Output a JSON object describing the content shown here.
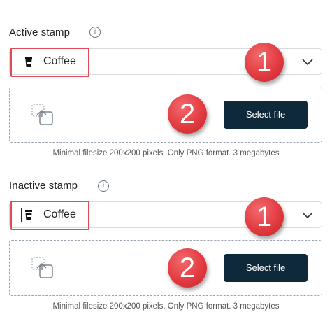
{
  "active_stamp": {
    "title": "Active stamp",
    "info_icon": "i",
    "select_value": "Coffee",
    "select_icon": "coffee-cup-icon",
    "select_file_label": "Select file",
    "helper_text": "Minimal filesize 200x200 pixels. Only PNG format. 3 megabytes",
    "badges": [
      "1",
      "2"
    ]
  },
  "inactive_stamp": {
    "title": "Inactive stamp",
    "info_icon": "i",
    "select_value": "Coffee",
    "select_icon": "coffee-cup-icon",
    "select_file_label": "Select file",
    "helper_text": "Minimal filesize 200x200 pixels. Only PNG format. 3 megabytes",
    "badges": [
      "1",
      "2"
    ]
  },
  "colors": {
    "highlight": "#e24a56",
    "badge": "#e23b41",
    "button": "#0e2a3a"
  }
}
